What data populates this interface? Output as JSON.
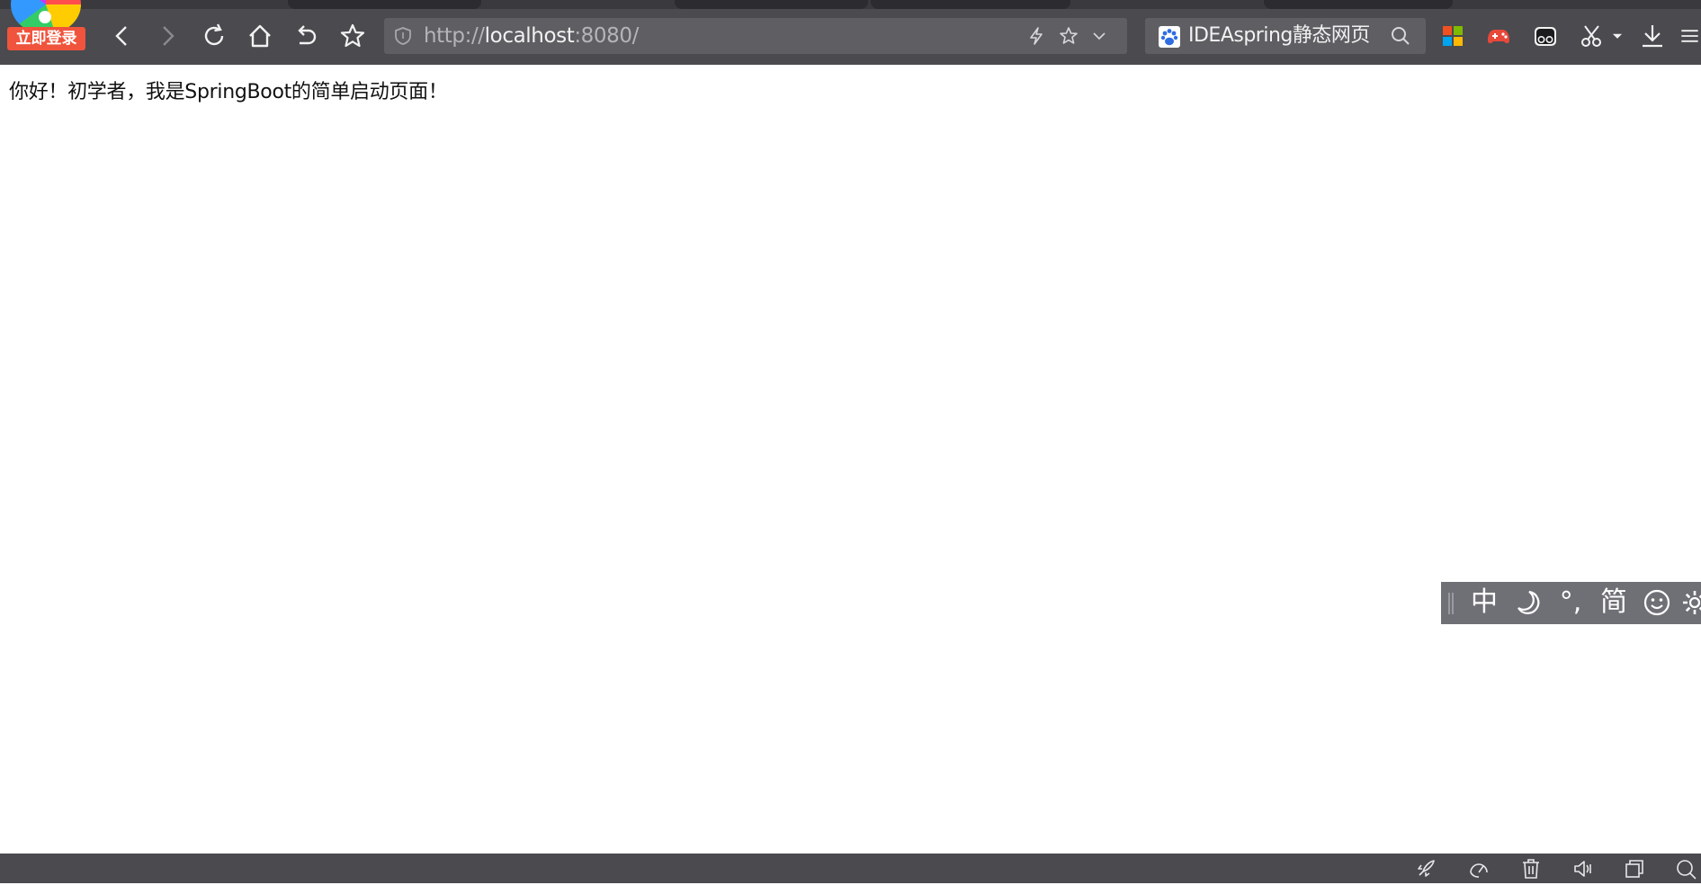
{
  "browser": {
    "login_badge": "立即登录",
    "address_bar": {
      "url_scheme": "http://",
      "url_host": "localhost",
      "url_rest": ":8080/"
    },
    "search_box": {
      "text": "IDEAspring静态网页"
    },
    "toolbar_icons": [
      "back-icon",
      "forward-icon",
      "reload-icon",
      "home-icon",
      "undo-icon",
      "bookmark-star-icon"
    ],
    "address_icons": [
      "shield-icon",
      "lightning-icon",
      "star-icon",
      "chevron-down-icon"
    ],
    "extension_icons": [
      "windows-grid-icon",
      "gamepad-icon",
      "mask-icon",
      "scissors-icon",
      "download-icon",
      "menu-icon"
    ]
  },
  "page": {
    "content_text": "你好！初学者，我是SpringBoot的简单启动页面！"
  },
  "ime_toolbar": {
    "lang": "中",
    "punct": "°,",
    "charset": "简",
    "icons": [
      "moon-icon",
      "emoji-icon",
      "gear-icon"
    ]
  },
  "statusbar": {
    "icons": [
      "rocket-icon",
      "speed-icon",
      "trash-icon",
      "volume-icon",
      "window-icon",
      "zoom-icon"
    ]
  },
  "colors": {
    "toolbar_bg": "#4a4a4f",
    "field_bg": "#5e5e63",
    "login_badge": "#f0543c",
    "ime_bg": "#6f7076"
  }
}
